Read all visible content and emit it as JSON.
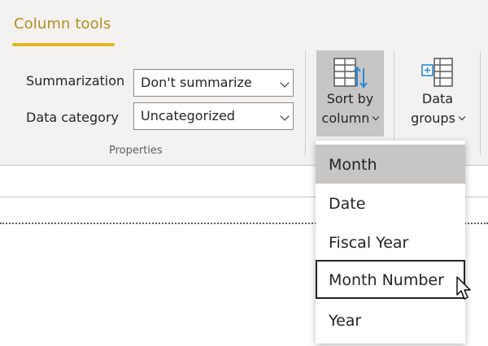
{
  "ribbon": {
    "tab_title": "Column tools",
    "properties": {
      "summarization_label": "Summarization",
      "summarization_value": "Don't summarize",
      "data_category_label": "Data category",
      "data_category_value": "Uncategorized",
      "group_label": "Properties"
    },
    "sort_by_column": {
      "line1": "Sort by",
      "line2": "column",
      "icon": "sort-by-column-icon"
    },
    "data_groups": {
      "line1": "Data",
      "line2": "groups",
      "icon": "data-groups-icon"
    }
  },
  "sort_menu": {
    "items": [
      {
        "label": "Month",
        "state": "selected"
      },
      {
        "label": "Date",
        "state": "normal"
      },
      {
        "label": "Fiscal Year",
        "state": "normal"
      },
      {
        "label": "Month Number",
        "state": "hovered"
      },
      {
        "label": "Year",
        "state": "normal"
      }
    ]
  },
  "colors": {
    "accent_gold": "#e3b718",
    "tab_title": "#b38f1e",
    "ribbon_bg": "#f3f2f1",
    "pressed_bg": "#c8c6c4",
    "icon_blue": "#2b88d8"
  }
}
